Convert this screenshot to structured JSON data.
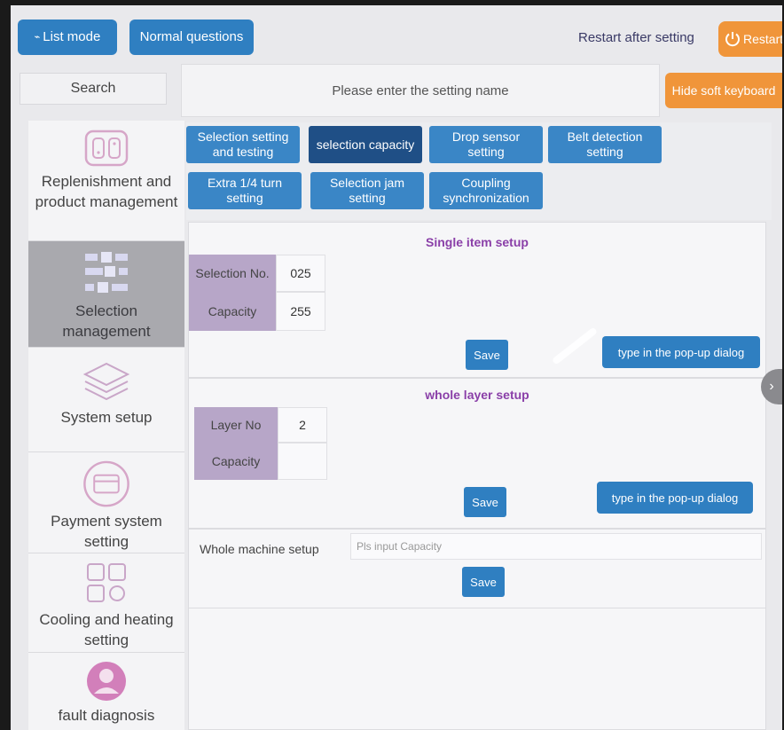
{
  "topbar": {
    "list_mode_label": "List mode",
    "normal_questions_label": "Normal questions",
    "restart_text": "Restart after setting",
    "restart_button_label": "Restart"
  },
  "search": {
    "button_label": "Search",
    "input_placeholder": "Please enter the setting name",
    "hide_keyboard_label": "Hide soft keyboard"
  },
  "sidebar": {
    "items": [
      {
        "label": "Replenishment and product management",
        "icon": "phone-icon"
      },
      {
        "label": "Selection management",
        "icon": "selection-icon"
      },
      {
        "label": "System setup",
        "icon": "layers-icon"
      },
      {
        "label": "Payment system setting",
        "icon": "card-icon"
      },
      {
        "label": "Cooling and heating setting",
        "icon": "grid-icon"
      },
      {
        "label": "fault diagnosis",
        "icon": "user-icon"
      }
    ]
  },
  "tabs": [
    {
      "label": "Selection setting and testing"
    },
    {
      "label": "selection capacity"
    },
    {
      "label": "Drop sensor setting"
    },
    {
      "label": "Belt detection setting"
    },
    {
      "label": "Extra 1/4 turn setting"
    },
    {
      "label": "Selection jam setting"
    },
    {
      "label": "Coupling synchronization"
    }
  ],
  "single_item": {
    "title": "Single item setup",
    "selection_no_label": "Selection No.",
    "selection_no_value": "025",
    "capacity_label": "Capacity",
    "capacity_value": "255",
    "save_label": "Save",
    "popup_label": "type in the pop-up dialog"
  },
  "whole_layer": {
    "title": "whole layer setup",
    "layer_no_label": "Layer No",
    "layer_no_value": "2",
    "capacity_label": "Capacity",
    "capacity_value": "",
    "save_label": "Save",
    "popup_label": "type in the pop-up dialog"
  },
  "whole_machine": {
    "label": "Whole machine setup",
    "input_placeholder": "Pls input Capacity",
    "save_label": "Save"
  },
  "colors": {
    "button_blue": "#2f7fc1",
    "tab_active": "#1f4f86",
    "orange": "#f0953a",
    "section_title": "#8a3fa8",
    "label_bg": "#b7a6c8"
  }
}
